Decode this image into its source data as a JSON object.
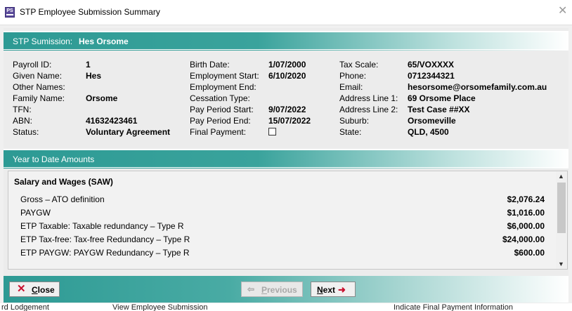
{
  "window": {
    "title": "STP Employee Submission Summary",
    "app_icon_text": "PS"
  },
  "header": {
    "label": "STP Sumission:",
    "employee_name": "Hes Orsome"
  },
  "details": {
    "col1": [
      {
        "label": "Payroll ID:",
        "value": "1"
      },
      {
        "label": "Given Name:",
        "value": "Hes"
      },
      {
        "label": "Other Names:",
        "value": ""
      },
      {
        "label": "Family Name:",
        "value": "Orsome"
      },
      {
        "label": "TFN:",
        "value": ""
      },
      {
        "label": "ABN:",
        "value": "41632423461"
      },
      {
        "label": "Status:",
        "value": "Voluntary Agreement"
      }
    ],
    "col2": [
      {
        "label": "Birth Date:",
        "value": "1/07/2000"
      },
      {
        "label": "Employment Start:",
        "value": "6/10/2020"
      },
      {
        "label": "Employment End:",
        "value": ""
      },
      {
        "label": "Cessation Type:",
        "value": ""
      },
      {
        "label": "Pay Period Start:",
        "value": "9/07/2022"
      },
      {
        "label": "Pay Period End:",
        "value": "15/07/2022"
      },
      {
        "label": "Final Payment:",
        "value": ""
      }
    ],
    "col3": [
      {
        "label": "Tax Scale:",
        "value": "65/VOXXXX"
      },
      {
        "label": "Phone:",
        "value": "0712344321"
      },
      {
        "label": "Email:",
        "value": "hesorsome@orsomefamily.com.au"
      },
      {
        "label": "Address Line 1:",
        "value": "69 Orsome Place"
      },
      {
        "label": "Address Line 2:",
        "value": "Test Case ##XX"
      },
      {
        "label": "Suburb:",
        "value": "Orsomeville"
      },
      {
        "label": "State:",
        "value": "QLD, 4500"
      }
    ],
    "final_payment_checked": false
  },
  "ytd": {
    "title": "Year to Date Amounts",
    "section": "Salary and Wages  (SAW)",
    "rows": [
      {
        "label": "Gross – ATO definition",
        "value": "$2,076.24"
      },
      {
        "label": "PAYGW",
        "value": "$1,016.00"
      },
      {
        "label": "ETP Taxable: Taxable redundancy  –  Type  R",
        "value": "$6,000.00"
      },
      {
        "label": "ETP Tax-free: Tax-free Redundancy  –  Type  R",
        "value": "$24,000.00"
      },
      {
        "label": "ETP PAYGW: PAYGW Redundancy  –  Type  R",
        "value": "$600.00"
      }
    ]
  },
  "buttons": {
    "close": {
      "underlined": "C",
      "rest": "lose",
      "icon": "x-icon"
    },
    "previous": {
      "underlined": "P",
      "rest": "revious",
      "enabled": false,
      "icon": "arrow-left-icon"
    },
    "next": {
      "underlined": "N",
      "rest": "ext",
      "icon": "arrow-right-icon"
    }
  },
  "background_window": {
    "fragments": [
      "rd Lodgement",
      "View Employee Submission",
      "Indicate Final Payment Information"
    ]
  },
  "colors": {
    "band_teal": "#2d9a94",
    "accent_red": "#c8102e",
    "icon_purple": "#5a4a9a"
  }
}
